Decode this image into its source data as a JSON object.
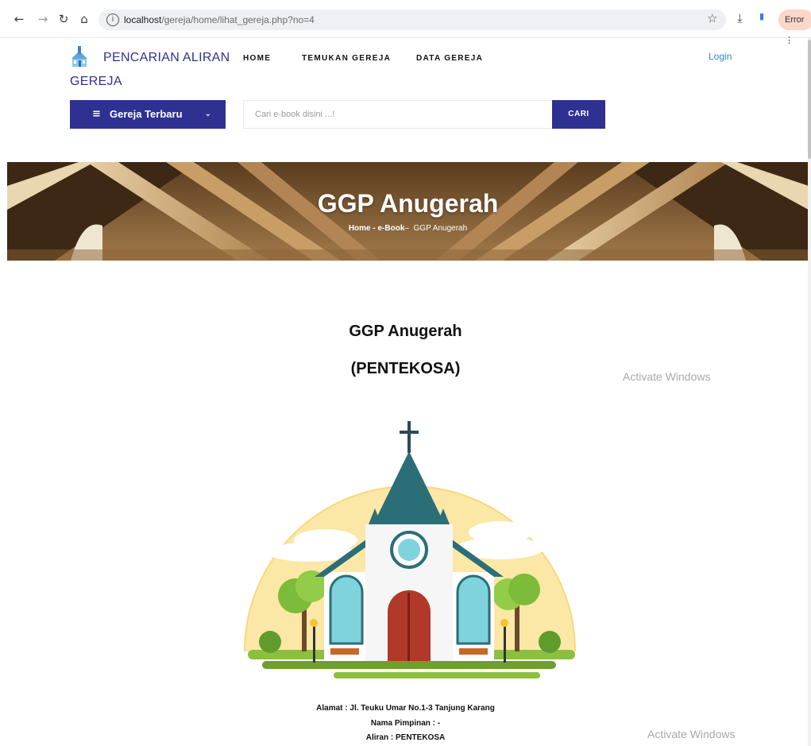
{
  "browser": {
    "url_host": "localhost",
    "url_path": "/gereja/home/lihat_gereja.php?no=4",
    "error_label": "Error"
  },
  "site": {
    "brand": "PENCARIAN ALIRAN GEREJA",
    "menu": [
      "HOME",
      "TEMUKAN GEREJA",
      "DATA GEREJA"
    ],
    "login": "Login",
    "category_button": "Gereja Terbaru",
    "search_placeholder": "Cari e-book disini ...!",
    "search_button": "CARI",
    "accent_color": "#2e3192"
  },
  "banner": {
    "title": "GGP Anugerah",
    "crumb_home": "Home - e-Book",
    "crumb_sep": "–",
    "crumb_current": "GGP Anugerah"
  },
  "content": {
    "name": "GGP Anugerah",
    "aliran_heading": "(PENTEKOSA)",
    "alamat": "Alamat : Jl. Teuku Umar No.1-3 Tanjung Karang",
    "pimpinan": "Nama Pimpinan : -",
    "aliran": "Aliran : PENTEKOSA"
  },
  "os": {
    "watermark": "Activate Windows"
  }
}
